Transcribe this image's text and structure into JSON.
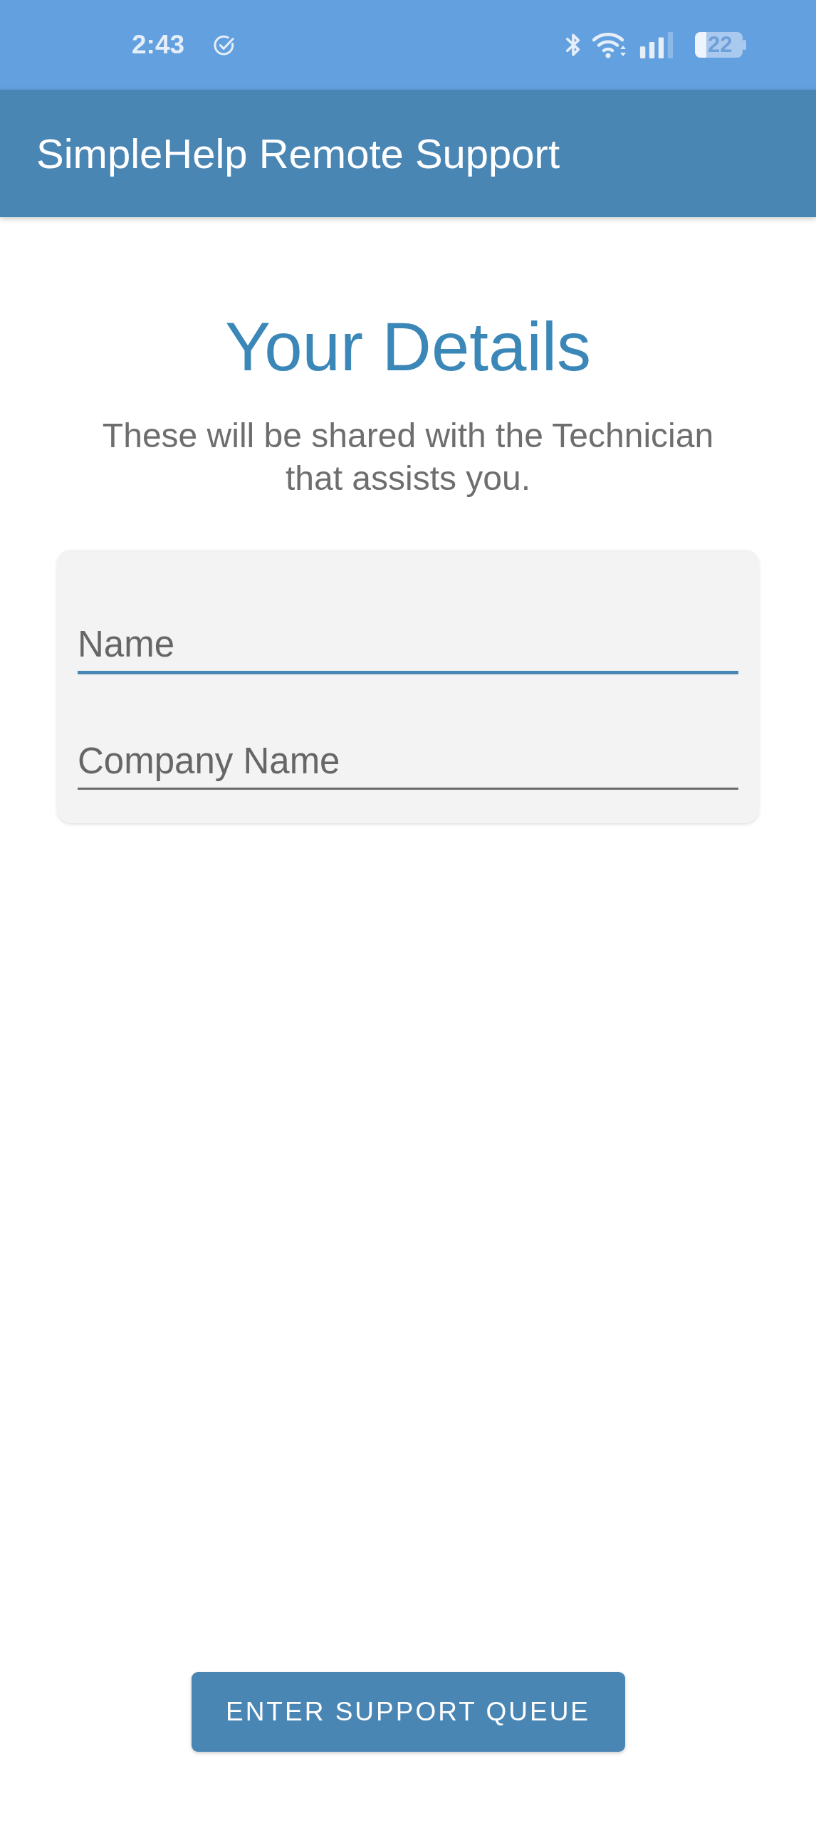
{
  "status_bar": {
    "time": "2:43",
    "battery": "22"
  },
  "app_bar": {
    "title": "SimpleHelp Remote Support"
  },
  "heading": "Your Details",
  "subtitle": "These will be shared with the Technician that assists you.",
  "form": {
    "fields": [
      {
        "placeholder": "Name",
        "focused": true
      },
      {
        "placeholder": "Company Name",
        "focused": false
      }
    ]
  },
  "button": {
    "label": "ENTER SUPPORT QUEUE"
  }
}
